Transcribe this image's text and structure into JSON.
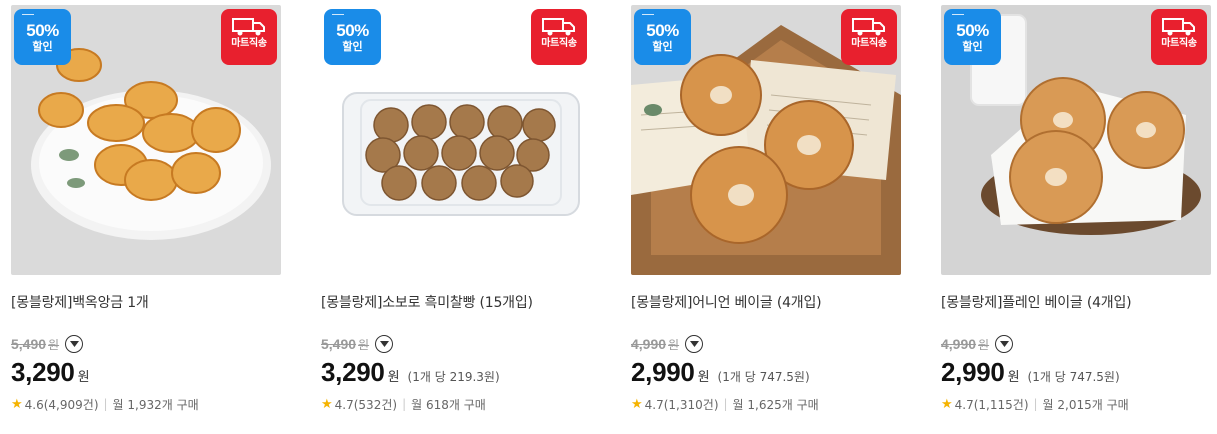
{
  "products": [
    {
      "title": "[몽블랑제]백옥앙금 1개",
      "original_price": "5,490",
      "price": "3,290",
      "unit_price": "",
      "rating": "4.6(4,909건)",
      "monthly": "월 1,932개 구매",
      "image": "white-bean-pastries-on-plate"
    },
    {
      "title": "[몽블랑제]소보로 흑미찰빵 (15개입)",
      "original_price": "5,490",
      "price": "3,290",
      "unit_price": "(1개 당 219.3원)",
      "rating": "4.7(532건)",
      "monthly": "월 618개 구매",
      "image": "soboro-black-rice-buns-in-clear-box"
    },
    {
      "title": "[몽블랑제]어니언 베이글 (4개입)",
      "original_price": "4,990",
      "price": "2,990",
      "unit_price": "(1개 당 747.5원)",
      "rating": "4.7(1,310건)",
      "monthly": "월 1,625개 구매",
      "image": "onion-bagels-on-wooden-board"
    },
    {
      "title": "[몽블랑제]플레인 베이글 (4개입)",
      "original_price": "4,990",
      "price": "2,990",
      "unit_price": "(1개 당 747.5원)",
      "rating": "4.7(1,115건)",
      "monthly": "월 2,015개 구매",
      "image": "plain-bagels-in-basket"
    }
  ],
  "badges": {
    "sale_percent": "50%",
    "sale_label": "할인",
    "delivery_label": "마트직송"
  },
  "currency": "원",
  "star_glyph": "★",
  "colors": {
    "sale_badge": "#1a8ce8",
    "delivery_badge": "#e8202e",
    "star": "#f5b301"
  }
}
